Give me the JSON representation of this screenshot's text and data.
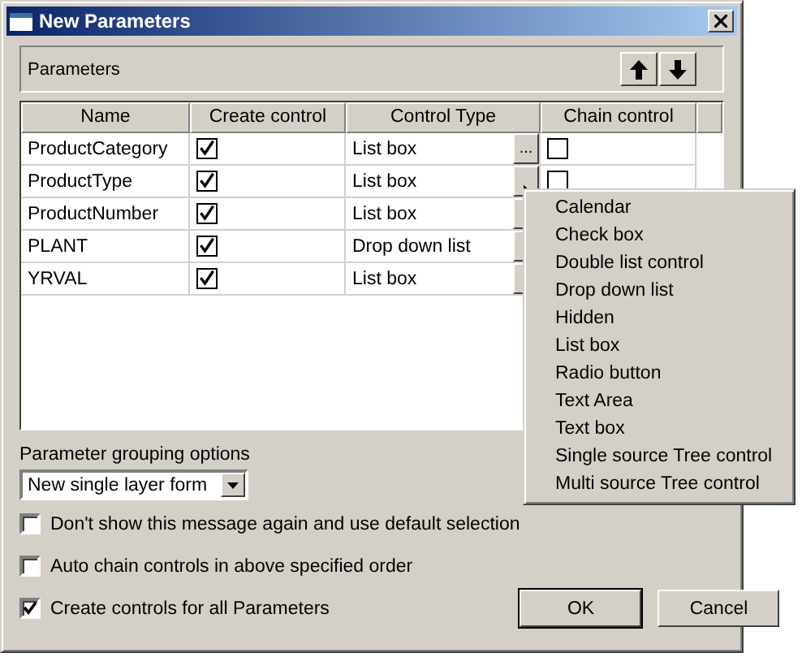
{
  "window": {
    "title": "New Parameters"
  },
  "parameters_group": {
    "label": "Parameters"
  },
  "table": {
    "columns": [
      "Name",
      "Create control",
      "Control Type",
      "Chain control"
    ],
    "rows": [
      {
        "name": "ProductCategory",
        "create_control": true,
        "control_type": "List box",
        "button_label": "...",
        "chain_control": false
      },
      {
        "name": "ProductType",
        "create_control": true,
        "control_type": "List box",
        "chain_control": false
      },
      {
        "name": "ProductNumber",
        "create_control": true,
        "control_type": "List box"
      },
      {
        "name": "PLANT",
        "create_control": true,
        "control_type": "Drop down list"
      },
      {
        "name": "YRVAL",
        "create_control": true,
        "control_type": "List box"
      }
    ]
  },
  "grouping": {
    "label": "Parameter grouping options",
    "value": "New single layer form"
  },
  "options": [
    {
      "label": "Don't show this message again and use default selection",
      "checked": false
    },
    {
      "label": "Auto chain controls in above specified order",
      "checked": false
    },
    {
      "label": "Create controls for all Parameters",
      "checked": true
    }
  ],
  "buttons": [
    "OK",
    "Cancel"
  ],
  "context_menu": {
    "items": [
      "Calendar",
      "Check box",
      "Double list control",
      "Drop down list",
      "Hidden",
      "List box",
      "Radio button",
      "Text Area",
      "Text box",
      "Single source Tree control",
      "Multi source Tree control"
    ]
  }
}
